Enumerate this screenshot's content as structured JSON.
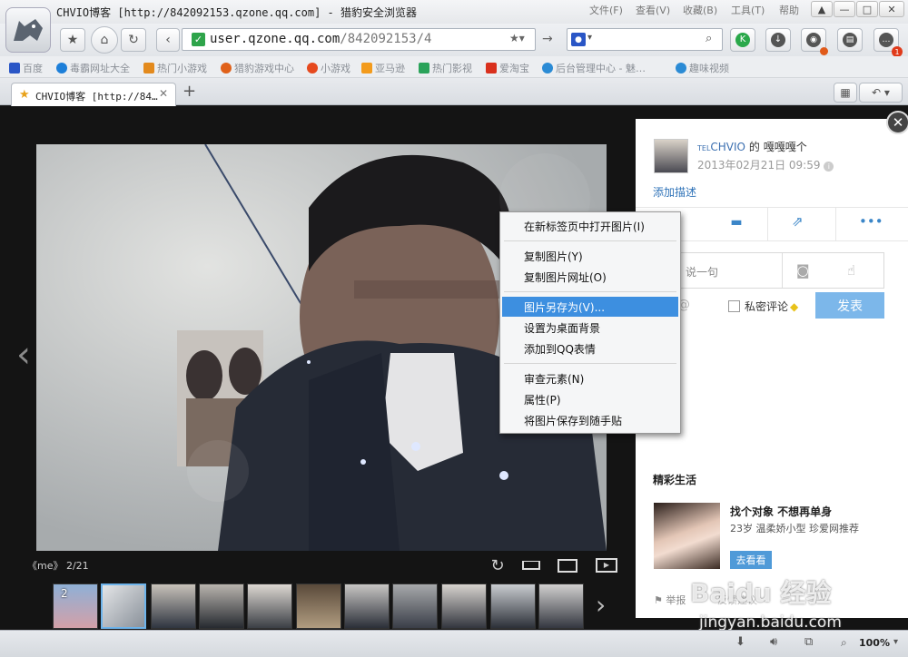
{
  "titlebar": {
    "title": "CHVIO博客 [http://842092153.qzone.qq.com] - 猎豹安全浏览器",
    "menus": [
      "文件(F)",
      "查看(V)",
      "收藏(B)",
      "工具(T)",
      "帮助"
    ]
  },
  "navbar": {
    "url_host": "user.qzone.qq.com",
    "url_path": "/842092153/4"
  },
  "bookmarks": [
    {
      "label": "百度",
      "color": "#2a56c6"
    },
    {
      "label": "毒霸网址大全",
      "color": "#1d7fd9"
    },
    {
      "label": "热门小游戏",
      "color": "#e38a1d"
    },
    {
      "label": "猎豹游戏中心",
      "color": "#e0611a"
    },
    {
      "label": "小游戏",
      "color": "#e6491e"
    },
    {
      "label": "亚马逊",
      "color": "#f39b1c"
    },
    {
      "label": "热门影视",
      "color": "#2aa35a"
    },
    {
      "label": "爱淘宝",
      "color": "#d9301d"
    },
    {
      "label": "后台管理中心 - 魅…",
      "color": "#2b8bd5"
    },
    {
      "label": "趣味视频",
      "color": "#2b8bd5"
    }
  ],
  "tab": {
    "title": "CHVIO博客 [http://84…"
  },
  "viewer": {
    "caption": "《me》 2/21",
    "thumb_badge": "2"
  },
  "panel": {
    "author_prefix": "TEL",
    "author": "CHVIO",
    "author_suffix": "的",
    "album": "嘎嘎嘎个",
    "time": "2013年02月21日 09:59",
    "add_desc": "添加描述",
    "comment_placeholder": "说一句",
    "private_label": "私密评论",
    "publish": "发表",
    "section_title": "精彩生活",
    "ad_title": "找个对象 不想再单身",
    "ad_desc": "23岁 温柔娇小型 珍爱网推荐",
    "ad_button": "去看看",
    "report": "举报",
    "report_extra": "反馈建议"
  },
  "context_menu": {
    "items": [
      "在新标签页中打开图片(I)",
      "复制图片(Y)",
      "复制图片网址(O)",
      "图片另存为(V)...",
      "设置为桌面背景",
      "添加到QQ表情",
      "审查元素(N)",
      "属性(P)",
      "将图片保存到随手贴"
    ],
    "highlighted_index": 3
  },
  "statusbar": {
    "zoom": "100%"
  },
  "watermark": {
    "brand": "Baidu 经验",
    "url": "jingyan.baidu.com"
  },
  "colors": {
    "accent": "#3d8fe0",
    "publish": "#7cb7ea",
    "panel_icon": "#3b86c8",
    "ad_button": "#4f9ad8"
  }
}
